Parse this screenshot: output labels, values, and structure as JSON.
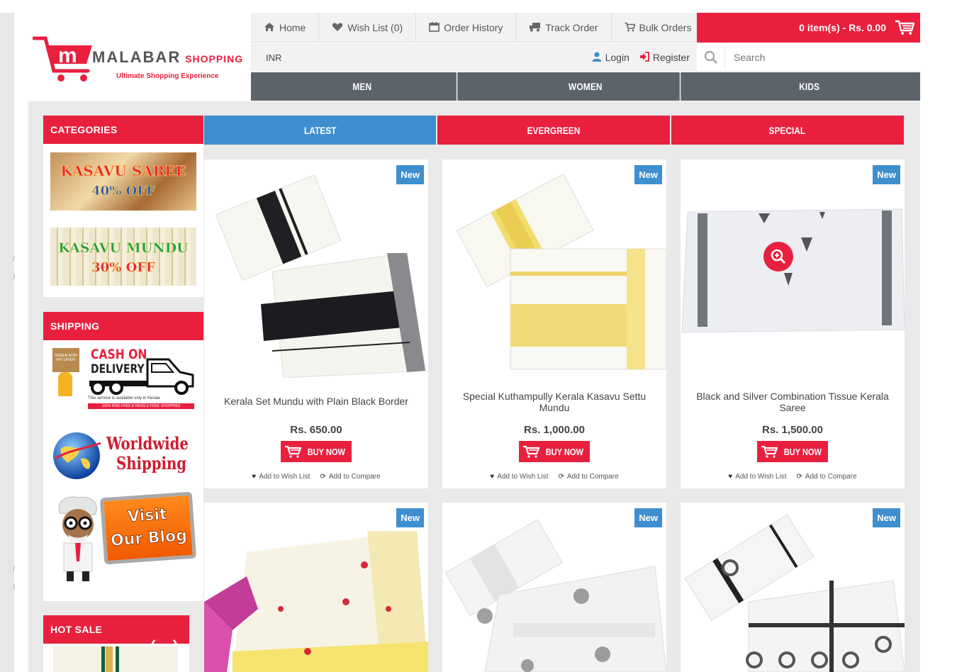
{
  "brand": {
    "name": "MALABAR",
    "name_suffix": "SHOPPING",
    "tagline": "Ultimate Shopping Experience",
    "logo_letter": "m",
    "accent": "#e8203e"
  },
  "topnav": [
    {
      "label": "Home",
      "icon": "home-icon"
    },
    {
      "label": "Wish List (0)",
      "icon": "heart-icon"
    },
    {
      "label": "Order History",
      "icon": "calendar-icon"
    },
    {
      "label": "Track Order",
      "icon": "truck-icon"
    },
    {
      "label": "Bulk Orders",
      "icon": "cart-icon"
    }
  ],
  "cart": {
    "summary": "0 item(s) - Rs. 0.00",
    "icon": "cart-icon"
  },
  "currency": "INR",
  "auth": {
    "login": "Login",
    "register": "Register"
  },
  "search": {
    "placeholder": "Search"
  },
  "category_nav": [
    "MEN",
    "WOMEN",
    "KIDS"
  ],
  "sidebar": {
    "categories_title": "CATEGORIES",
    "banners": [
      {
        "title": "KASAVU SAREE",
        "offer": "40% OFF"
      },
      {
        "title": "KASAVU MUNDU",
        "offer": "30% OFF"
      }
    ],
    "shipping_title": "SHIPPING",
    "cod": {
      "line1": "CASH ON",
      "line2": "DELIVERY",
      "note": "This service is available only in Kerala",
      "strip": "100% RISK-FREE & HASSLE-FREE SHOPPING!",
      "box_text": "ORDER NOW PAY LATER!"
    },
    "worldwide": {
      "line1": "Worldwide",
      "line2": "Shipping"
    },
    "blog": {
      "line1": "Visit",
      "line2": "Our Blog"
    },
    "hot_sale_title": "HOT SALE"
  },
  "tabs": [
    {
      "label": "LATEST",
      "color": "#3f8fd0"
    },
    {
      "label": "EVERGREEN",
      "color": "#e8203e"
    },
    {
      "label": "SPECIAL",
      "color": "#e8203e"
    }
  ],
  "products": [
    {
      "badge": "New",
      "name": "Kerala Set Mundu with Plain Black Border",
      "price": "Rs. 650.00",
      "buy": "BUY NOW",
      "wish": "Add to Wish List",
      "compare": "Add to Compare"
    },
    {
      "badge": "New",
      "name": "Special Kuthampully Kerala Kasavu Settu Mundu",
      "price": "Rs. 1,000.00",
      "buy": "BUY NOW",
      "wish": "Add to Wish List",
      "compare": "Add to Compare"
    },
    {
      "badge": "New",
      "name": "Black and Silver Combination Tissue Kerala Saree",
      "price": "Rs. 1,500.00",
      "buy": "BUY NOW",
      "wish": "Add to Wish List",
      "compare": "Add to Compare"
    },
    {
      "badge": "New"
    },
    {
      "badge": "New"
    },
    {
      "badge": "New"
    }
  ]
}
